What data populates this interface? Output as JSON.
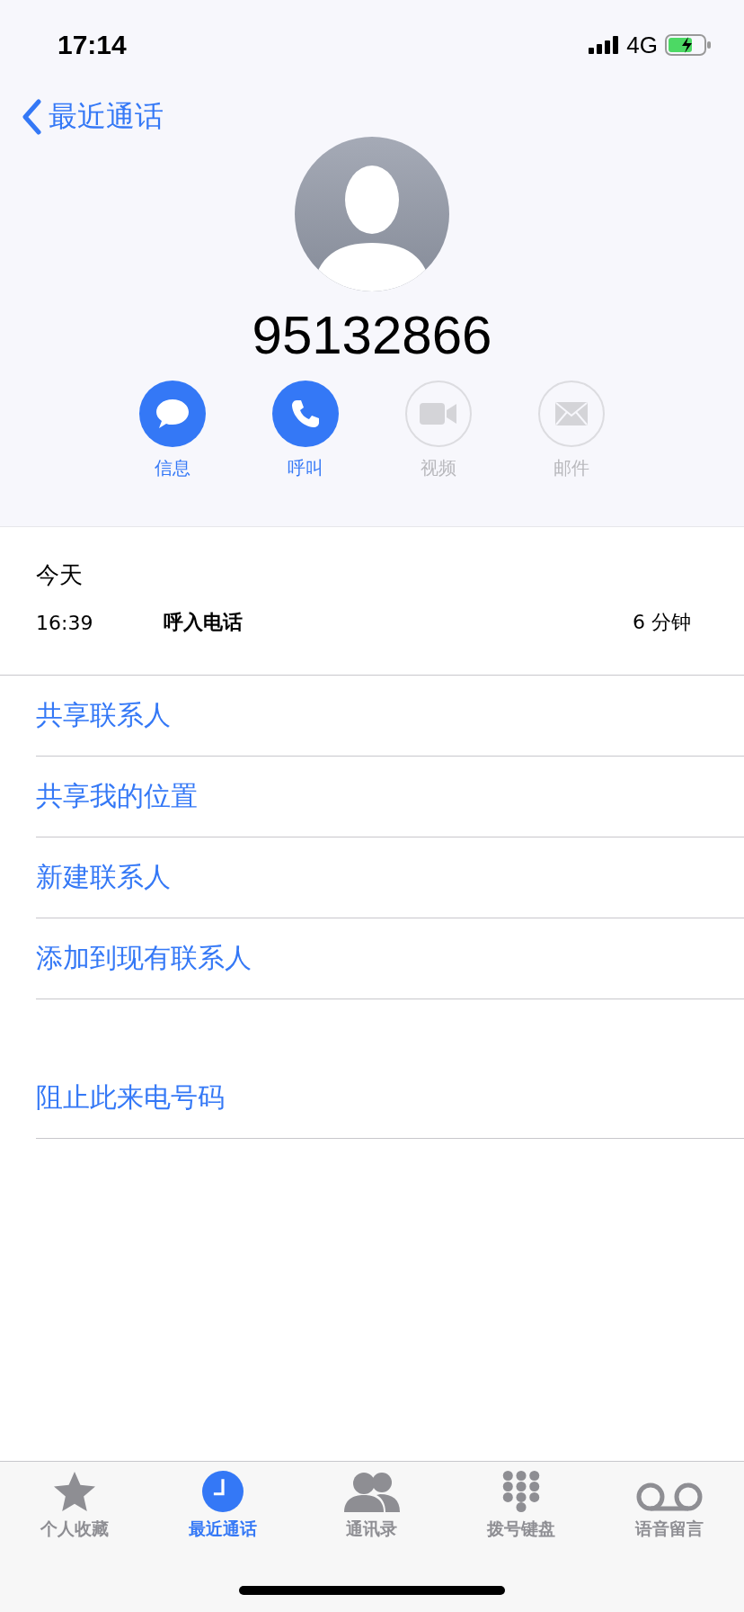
{
  "status_bar": {
    "time": "17:14",
    "network": "4G"
  },
  "nav": {
    "back_label": "最近通话"
  },
  "contact": {
    "number": "95132866"
  },
  "actions": [
    {
      "kind": "message",
      "label": "信息",
      "disabled": false
    },
    {
      "kind": "call",
      "label": "呼叫",
      "disabled": false
    },
    {
      "kind": "video",
      "label": "视频",
      "disabled": true
    },
    {
      "kind": "mail",
      "label": "邮件",
      "disabled": true
    }
  ],
  "call_log": {
    "date": "今天",
    "entries": [
      {
        "time": "16:39",
        "type": "呼入电话",
        "duration": "6 分钟"
      }
    ]
  },
  "options": [
    "共享联系人",
    "共享我的位置",
    "新建联系人",
    "添加到现有联系人"
  ],
  "block_option": "阻止此来电号码",
  "tabs": [
    {
      "kind": "favorites",
      "label": "个人收藏",
      "selected": false
    },
    {
      "kind": "recents",
      "label": "最近通话",
      "selected": true
    },
    {
      "kind": "contacts",
      "label": "通讯录",
      "selected": false
    },
    {
      "kind": "keypad",
      "label": "拨号键盘",
      "selected": false
    },
    {
      "kind": "voicemail",
      "label": "语音留言",
      "selected": false
    }
  ]
}
